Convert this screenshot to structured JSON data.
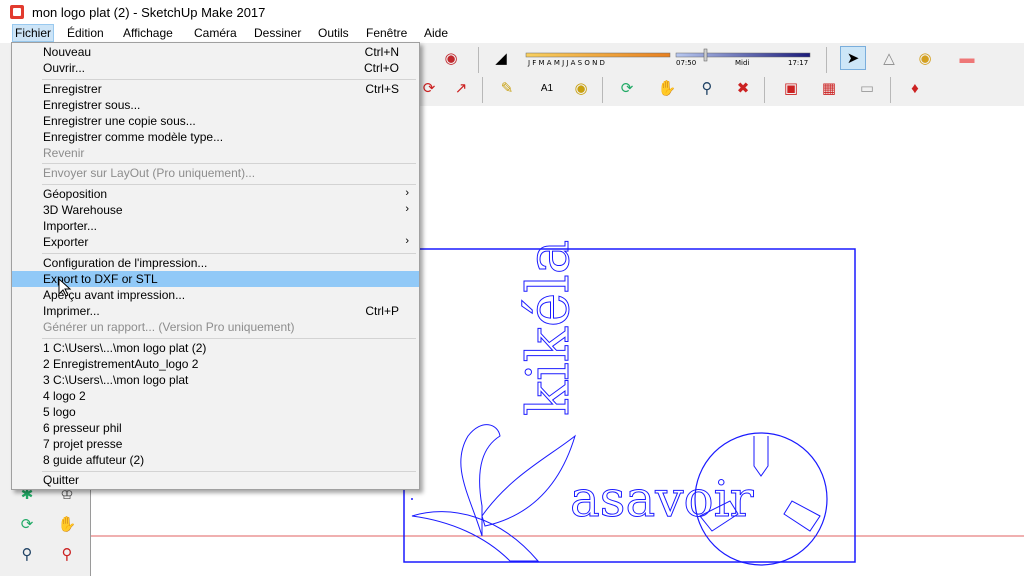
{
  "window": {
    "title": "mon logo plat (2) - SketchUp Make 2017"
  },
  "menubar": {
    "items": [
      "Fichier",
      "Édition",
      "Affichage",
      "Caméra",
      "Dessiner",
      "Outils",
      "Fenêtre",
      "Aide"
    ]
  },
  "file_menu": {
    "items": [
      {
        "label": "Nouveau",
        "shortcut": "Ctrl+N"
      },
      {
        "label": "Ouvrir...",
        "shortcut": "Ctrl+O"
      },
      {
        "label": "Enregistrer",
        "shortcut": "Ctrl+S"
      },
      {
        "label": "Enregistrer sous..."
      },
      {
        "label": "Enregistrer une copie sous..."
      },
      {
        "label": "Enregistrer comme modèle type..."
      },
      {
        "label": "Revenir"
      },
      {
        "label": "Envoyer sur LayOut (Pro uniquement)..."
      },
      {
        "label": "Géoposition"
      },
      {
        "label": "3D Warehouse"
      },
      {
        "label": "Importer..."
      },
      {
        "label": "Exporter"
      },
      {
        "label": "Configuration de l'impression..."
      },
      {
        "label": "Export to DXF or STL"
      },
      {
        "label": "Aperçu avant impression..."
      },
      {
        "label": "Imprimer...",
        "shortcut": "Ctrl+P"
      },
      {
        "label": "Générer un rapport... (Version Pro uniquement)"
      },
      {
        "label": "1 C:\\Users\\...\\mon logo plat (2)"
      },
      {
        "label": "2 EnregistrementAuto_logo 2"
      },
      {
        "label": "3 C:\\Users\\...\\mon logo plat"
      },
      {
        "label": "4 logo 2"
      },
      {
        "label": "5 logo"
      },
      {
        "label": "6 presseur phil"
      },
      {
        "label": "7 projet presse"
      },
      {
        "label": "8 guide affuteur (2)"
      },
      {
        "label": "Quitter"
      }
    ]
  },
  "shadow_settings": {
    "months": "J F M A M J J A S O N D",
    "time_start": "07:50",
    "time_mid": "Midi",
    "time_end": "17:17"
  },
  "model": {
    "text_vertical": "kikéla",
    "text_horizontal": "asavoir"
  },
  "colors": {
    "menu_highlight": "#91c9f7",
    "model_lines": "#1a1aff",
    "axis_red": "#e06060"
  }
}
